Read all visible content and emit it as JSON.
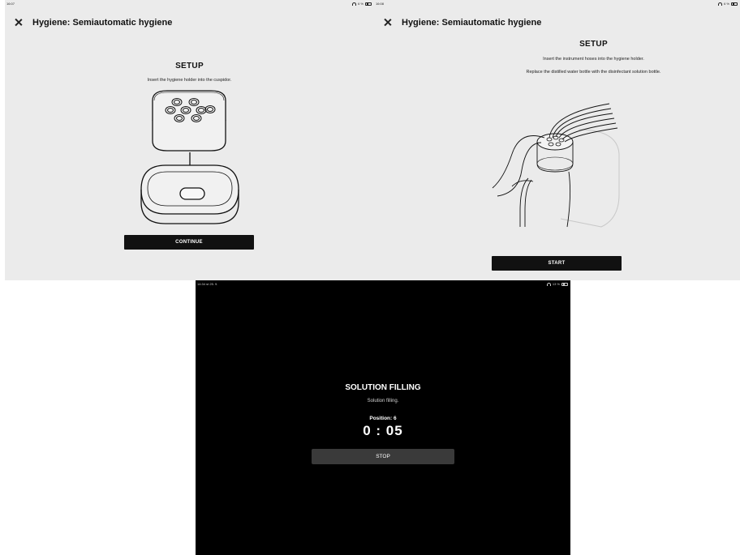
{
  "left_screen": {
    "status": {
      "time": "16:07",
      "right_text": "6 %"
    },
    "header_title": "Hygiene: Semiautomatic hygiene",
    "setup_title": "SETUP",
    "instruction": "Insert the hygiene holder into the cuspidor.",
    "button_label": "CONTINUE"
  },
  "right_screen": {
    "status": {
      "time": "16:08",
      "right_text": "6 %"
    },
    "header_title": "Hygiene: Semiautomatic hygiene",
    "setup_title": "SETUP",
    "instruction_1": "Insert the instrument hoses into the hygiene holder.",
    "instruction_2": "Replace the distilled water bottle with the disinfectant solution bottle.",
    "button_label": "START"
  },
  "dark_screen": {
    "status": {
      "time": "14:34  st 25. 9.",
      "right_text": "13 %"
    },
    "title": "SOLUTION FILLING",
    "subtitle": "Solution filling.",
    "position_label": "Position: 6",
    "timer": "0 : 05",
    "stop_label": "STOP"
  }
}
